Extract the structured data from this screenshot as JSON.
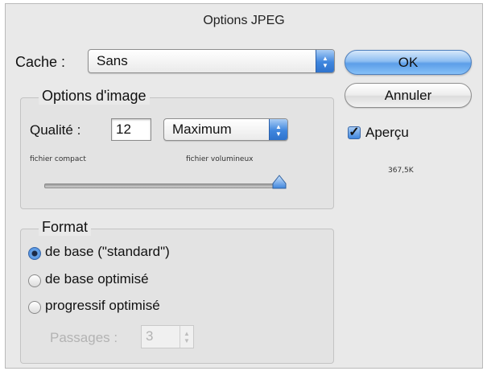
{
  "dialog": {
    "title": "Options JPEG",
    "matte_label": "Cache :",
    "matte_value": "Sans",
    "ok_label": "OK",
    "cancel_label": "Annuler",
    "preview_label": "Aperçu",
    "preview_checked": true,
    "file_size": "367,5K"
  },
  "image_options": {
    "group_title": "Options d'image",
    "quality_label": "Qualité :",
    "quality_value": "12",
    "quality_preset": "Maximum",
    "small_file_label": "fichier compact",
    "large_file_label": "fichier volumineux",
    "slider_level": 1.0
  },
  "format": {
    "group_title": "Format",
    "options": [
      {
        "label": "de base (\"standard\")",
        "selected": true
      },
      {
        "label": "de base optimisé",
        "selected": false
      },
      {
        "label": "progressif optimisé",
        "selected": false
      }
    ],
    "scans_label": "Passages :",
    "scans_value": "3"
  },
  "colors": {
    "accent_blue": "#3f86de",
    "dialog_bg": "#e9e9e9"
  },
  "icons": {
    "popup_arrows": "up-down-arrows-icon",
    "slider_thumb": "triangle-thumb-icon",
    "checkmark": "checkmark-icon"
  }
}
